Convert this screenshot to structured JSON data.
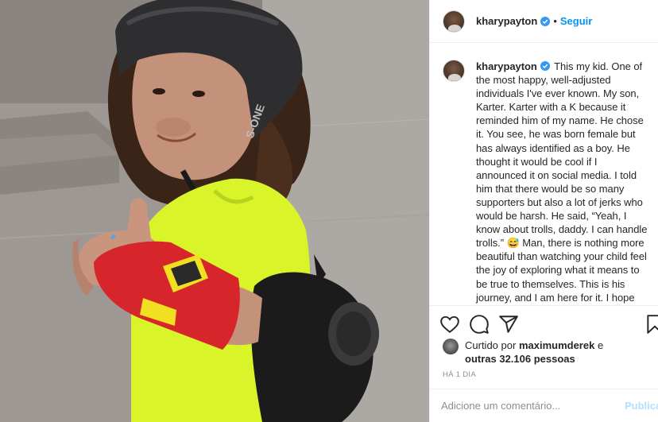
{
  "post": {
    "photo_alt": "photo",
    "helmet_text": "S-ONE"
  },
  "header": {
    "username": "kharypayton",
    "separator": "•",
    "follow_label": "Seguir"
  },
  "caption": {
    "username": "kharypayton",
    "text": "This my kid. One of the most happy, well-adjusted individuals I've ever known. My son, Karter. Karter with a K because it reminded him of my name. He chose it. You see, he was born female but has always identified as a boy. He thought it would be cool if I announced it on social media. I told him that there would be so many supporters but also a lot of jerks who would be harsh. He said, “Yeah, I know about trolls, daddy. I can handle trolls.” 😅 Man, there is nothing more beautiful than watching your child feel the joy of exploring what it means to be true to themselves. This is his journey, and I am here for it. I hope you all have the opportunity to feel"
  },
  "actions": {
    "icons": [
      "heart-icon",
      "comment-icon",
      "share-icon",
      "bookmark-icon"
    ]
  },
  "likes": {
    "prefix": "Curtido por",
    "user": "maximumderek",
    "connector": "e",
    "others": "outras 32.106 pessoas"
  },
  "timestamp": "HÁ 1 DIA",
  "comment": {
    "placeholder": "Adicione um comentário...",
    "publish_label": "Publicar"
  },
  "colors": {
    "accent": "#0095f6",
    "verified": "#3897f0",
    "publish_disabled": "#b2dffc",
    "shirt": "#d9f52a",
    "wrist_guard": "#d7262b"
  }
}
